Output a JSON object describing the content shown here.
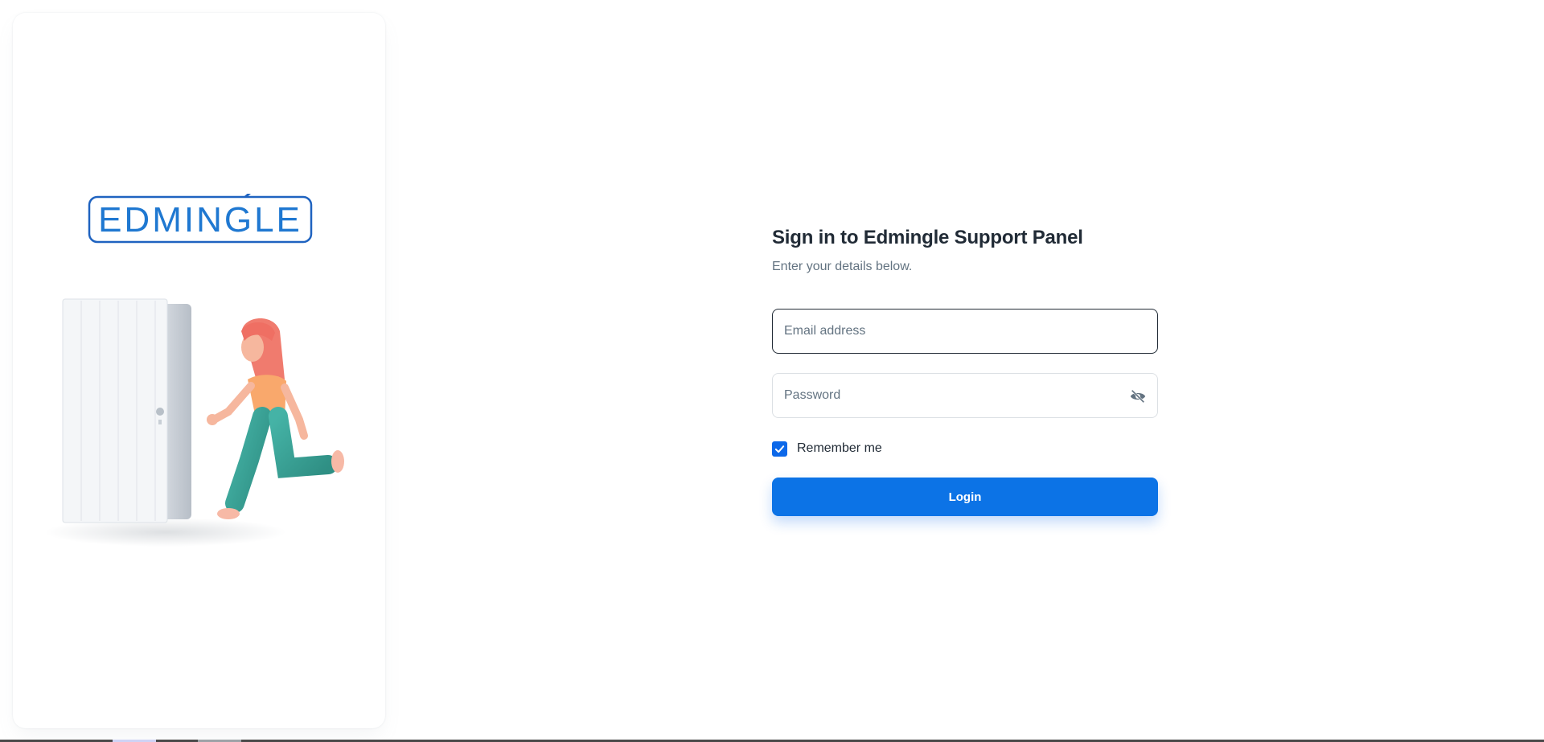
{
  "brand": {
    "logo_text": "EDMINGLE",
    "logo_color": "#1f6fc8"
  },
  "login": {
    "title": "Sign in to Edmingle Support Panel",
    "subtitle": "Enter your details below.",
    "email_placeholder": "Email address",
    "password_placeholder": "Password",
    "password_toggle_icon": "eye-off-icon",
    "remember_label": "Remember me",
    "remember_checked": true,
    "button_label": "Login"
  },
  "colors": {
    "primary": "#0c73e6",
    "text_primary": "#212b36",
    "text_secondary": "#637381"
  }
}
